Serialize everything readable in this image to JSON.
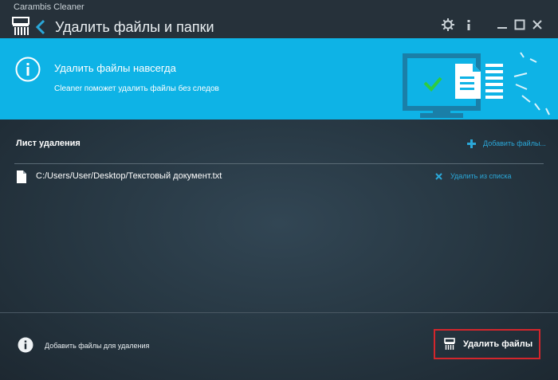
{
  "app": {
    "name": "Carambis Cleaner",
    "page_title": "Удалить файлы и папки"
  },
  "titlebar": {
    "icons": [
      "shredder-logo-icon",
      "back-arrow-icon",
      "gear-icon",
      "info-icon",
      "minimize-icon",
      "maximize-icon",
      "close-icon"
    ]
  },
  "banner": {
    "title": "Удалить файлы навсегда",
    "description": "Cleaner поможет удалить файлы без следов",
    "background": "#0eb3e6"
  },
  "list": {
    "title": "Лист удаления",
    "add_label": "Добавить файлы...",
    "files": [
      {
        "path": "C:/Users/User/Desktop/Текстовый документ.txt",
        "remove_label": "Удалить из списка"
      }
    ]
  },
  "footer": {
    "hint": "Добавить файлы для удаления",
    "delete_label": "Удалить файлы",
    "delete_border_color": "#d3262c"
  },
  "colors": {
    "accent": "#2aa7d8",
    "check": "#2ecc40"
  }
}
